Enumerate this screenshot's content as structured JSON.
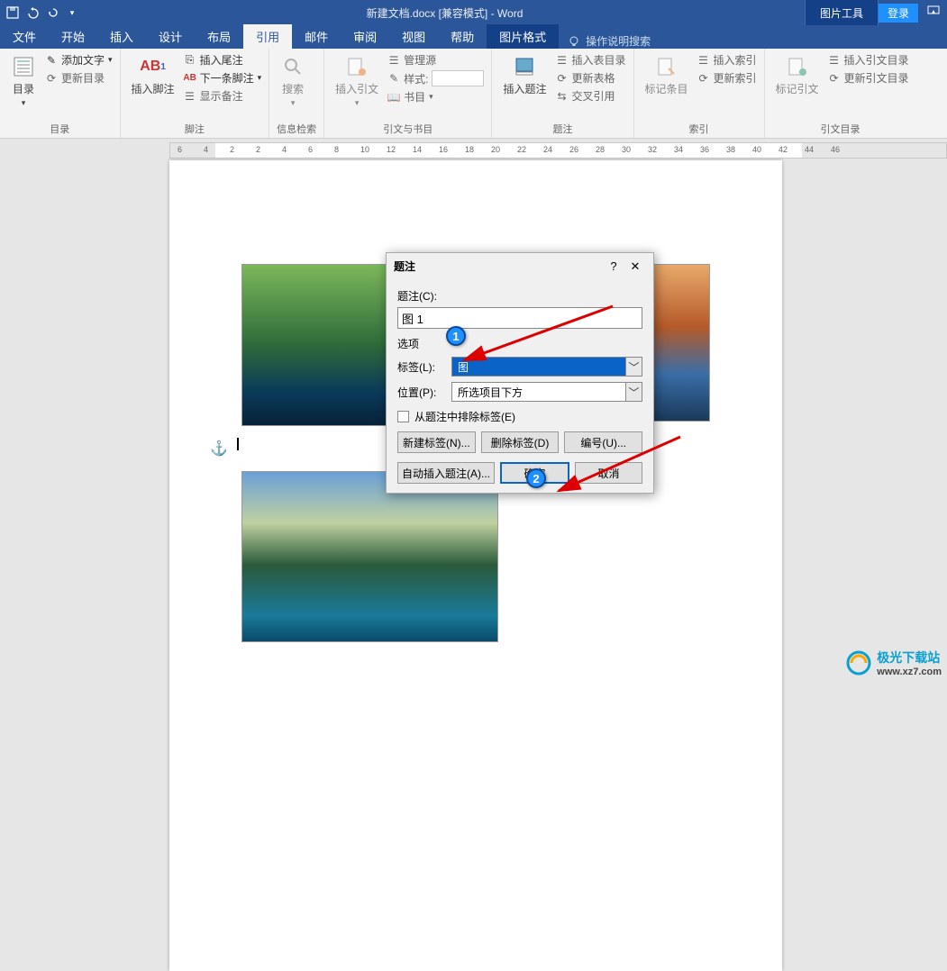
{
  "titlebar": {
    "doc_title": "新建文档.docx  [兼容模式]  -  Word",
    "pic_tools": "图片工具",
    "login": "登录"
  },
  "tabs": {
    "file": "文件",
    "home": "开始",
    "insert": "插入",
    "design": "设计",
    "layout": "布局",
    "references": "引用",
    "mailings": "邮件",
    "review": "审阅",
    "view": "视图",
    "help": "帮助",
    "pic_format": "图片格式",
    "tell_me": "操作说明搜索"
  },
  "ribbon": {
    "toc": {
      "label": "目录",
      "btn": "目录",
      "add_text": "添加文字",
      "update_toc": "更新目录"
    },
    "footnotes": {
      "label": "脚注",
      "btn": "插入脚注",
      "ab": "AB",
      "sup": "1",
      "insert_endnote": "插入尾注",
      "next_footnote": "下一条脚注",
      "show_notes": "显示备注"
    },
    "research": {
      "label": "信息检索",
      "btn": "搜索"
    },
    "citations": {
      "label": "引文与书目",
      "btn": "插入引文",
      "manage_sources": "管理源",
      "style": "样式:",
      "bibliography": "书目"
    },
    "captions": {
      "label": "题注",
      "btn": "插入题注",
      "insert_tof": "插入表目录",
      "update_table": "更新表格",
      "cross_ref": "交叉引用"
    },
    "index": {
      "label": "索引",
      "btn": "标记条目",
      "insert_index": "插入索引",
      "update_index": "更新索引"
    },
    "toa": {
      "label": "引文目录",
      "btn": "标记引文",
      "insert_toa": "插入引文目录",
      "update_toa": "更新引文目录"
    }
  },
  "ruler": {
    "marks": [
      "6",
      "4",
      "2",
      "2",
      "4",
      "6",
      "8",
      "10",
      "12",
      "14",
      "16",
      "18",
      "20",
      "22",
      "24",
      "26",
      "28",
      "30",
      "32",
      "34",
      "36",
      "38",
      "40",
      "42",
      "44",
      "46"
    ]
  },
  "dialog": {
    "title": "题注",
    "caption_label": "题注(C):",
    "caption_value": "图 1",
    "options": "选项",
    "label_lbl": "标签(L):",
    "label_val": "图",
    "position_lbl": "位置(P):",
    "position_val": "所选项目下方",
    "exclude_chk": "从题注中排除标签(E)",
    "new_label": "新建标签(N)...",
    "del_label": "删除标签(D)",
    "numbering": "编号(U)...",
    "auto_caption": "自动插入题注(A)...",
    "ok": "确定",
    "cancel": "取消"
  },
  "watermark": {
    "name": "极光下载站",
    "url": "www.xz7.com"
  },
  "badges": {
    "one": "1",
    "two": "2"
  }
}
